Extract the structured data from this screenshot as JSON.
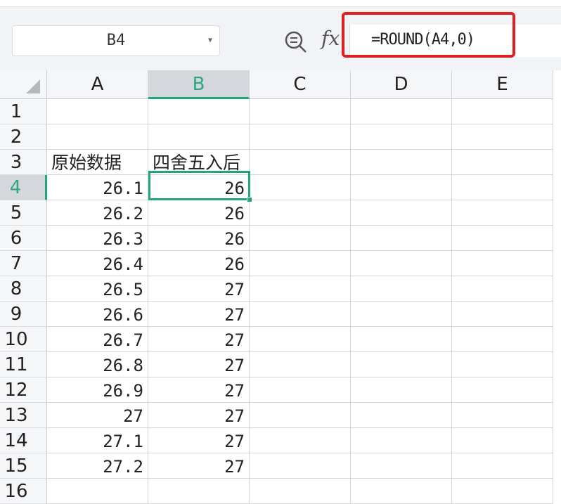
{
  "name_box": {
    "value": "B4"
  },
  "formula_bar": {
    "fx_label": "fx",
    "formula": "=ROUND(A4,0)",
    "highlight_color": "#e0201f"
  },
  "columns": [
    "A",
    "B",
    "C",
    "D",
    "E"
  ],
  "selected": {
    "column": "B",
    "row": "4"
  },
  "rows": [
    {
      "n": "1",
      "a": "",
      "b": ""
    },
    {
      "n": "2",
      "a": "",
      "b": ""
    },
    {
      "n": "3",
      "a": "原始数据",
      "b": "四舍五入后"
    },
    {
      "n": "4",
      "a": "26.1",
      "b": "26"
    },
    {
      "n": "5",
      "a": "26.2",
      "b": "26"
    },
    {
      "n": "6",
      "a": "26.3",
      "b": "26"
    },
    {
      "n": "7",
      "a": "26.4",
      "b": "26"
    },
    {
      "n": "8",
      "a": "26.5",
      "b": "27"
    },
    {
      "n": "9",
      "a": "26.6",
      "b": "27"
    },
    {
      "n": "10",
      "a": "26.7",
      "b": "27"
    },
    {
      "n": "11",
      "a": "26.8",
      "b": "27"
    },
    {
      "n": "12",
      "a": "26.9",
      "b": "27"
    },
    {
      "n": "13",
      "a": "27",
      "b": "27"
    },
    {
      "n": "14",
      "a": "27.1",
      "b": "27"
    },
    {
      "n": "15",
      "a": "27.2",
      "b": "27"
    },
    {
      "n": "16",
      "a": "",
      "b": ""
    }
  ],
  "accent_color": "#1fa67a"
}
